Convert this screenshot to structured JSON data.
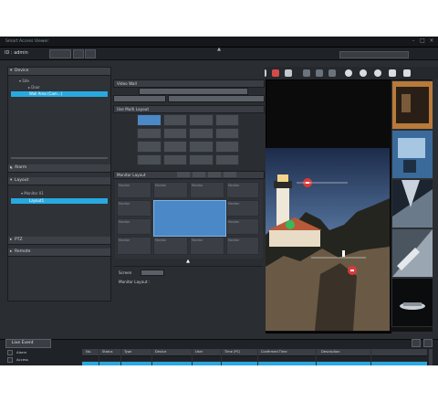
{
  "window": {
    "title": "Smart Access Viewer",
    "toolbar_id": "ID : admin",
    "controls": [
      "-",
      "□",
      "×"
    ]
  },
  "left_panel": {
    "sections": [
      {
        "id": "device",
        "label": "Device",
        "expanded": true
      },
      {
        "id": "alarm",
        "label": "Alarm",
        "expanded": false
      },
      {
        "id": "layout",
        "label": "Layout",
        "expanded": true
      },
      {
        "id": "ptz",
        "label": "PTZ",
        "expanded": false
      },
      {
        "id": "remote",
        "label": "Remote",
        "expanded": false
      }
    ],
    "device_tree": [
      {
        "label": "Site",
        "indent": 1
      },
      {
        "label": "Door",
        "indent": 2
      },
      {
        "label": "Wall Area (Cam...)",
        "indent": 2,
        "selected": true
      }
    ],
    "layout_tree": [
      {
        "label": "Monitor 01",
        "indent": 1
      },
      {
        "label": "Layout1",
        "indent": 1,
        "selected": true
      }
    ]
  },
  "middle": {
    "panel1_title": "Video Wall",
    "panel2_title": "Use Multi Layout",
    "panel3_title": "Monitor Layout",
    "screen_label": "Screen",
    "monitor_layout_label": "Monitor Layout :",
    "monitor_label": "Monitor"
  },
  "bottom": {
    "tab_label": "Live Event",
    "columns": [
      "No.",
      "Status",
      "Type",
      "Device",
      "User",
      "Time (PC)",
      "Confirmed Time",
      "Description"
    ],
    "filters": [
      "Alarm",
      "Access"
    ]
  },
  "colors": {
    "accent": "#29a9e0",
    "panel": "#2f3237",
    "background": "#2a2d31"
  }
}
